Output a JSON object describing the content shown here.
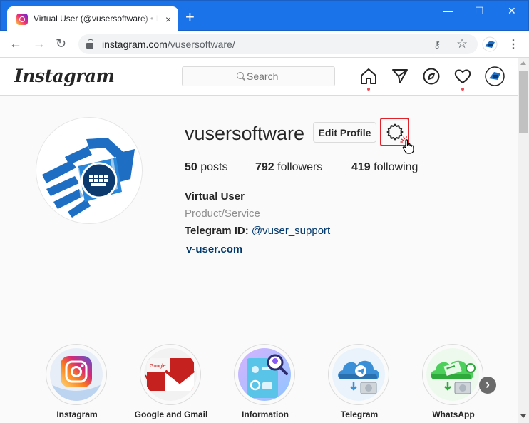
{
  "browser": {
    "tab_title": "Virtual User (@vusersoftware) • Instagram",
    "tab_close": "×",
    "new_tab": "+",
    "window_controls": {
      "minimize": "—",
      "maximize": "☐",
      "close": "✕"
    },
    "url_host": "instagram.com",
    "url_path": "/vusersoftware/",
    "nav": {
      "back": "←",
      "forward": "→",
      "reload": "↻"
    },
    "key_glyph": "⚷",
    "star_glyph": "☆",
    "menu_glyph": "⋮"
  },
  "instagram": {
    "logo": "Instagram",
    "search_placeholder": "Search",
    "nav_icons": [
      "home-icon",
      "direct-icon",
      "explore-icon",
      "activity-heart-icon",
      "profile-avatar"
    ],
    "accent_red": "#ed4956"
  },
  "profile": {
    "username": "vusersoftware",
    "edit_profile_label": "Edit Profile",
    "settings_highlight_color": "#e0232b",
    "stats": [
      {
        "count": "50",
        "label": "posts"
      },
      {
        "count": "792",
        "label": "followers"
      },
      {
        "count": "419",
        "label": "following"
      }
    ],
    "bio": {
      "name": "Virtual User",
      "category": "Product/Service",
      "telegram_label": "Telegram ID:",
      "telegram_handle": "@vuser_support",
      "website": "v-user.com"
    }
  },
  "highlights": [
    {
      "label": "Instagram",
      "icon": "instagram-logo-icon"
    },
    {
      "label": "Google and Gmail",
      "icon": "gmail-icon"
    },
    {
      "label": "Information",
      "icon": "information-icon"
    },
    {
      "label": "Telegram",
      "icon": "telegram-cloud-icon"
    },
    {
      "label": "WhatsApp",
      "icon": "whatsapp-cloud-icon"
    }
  ],
  "highlights_next": "›"
}
